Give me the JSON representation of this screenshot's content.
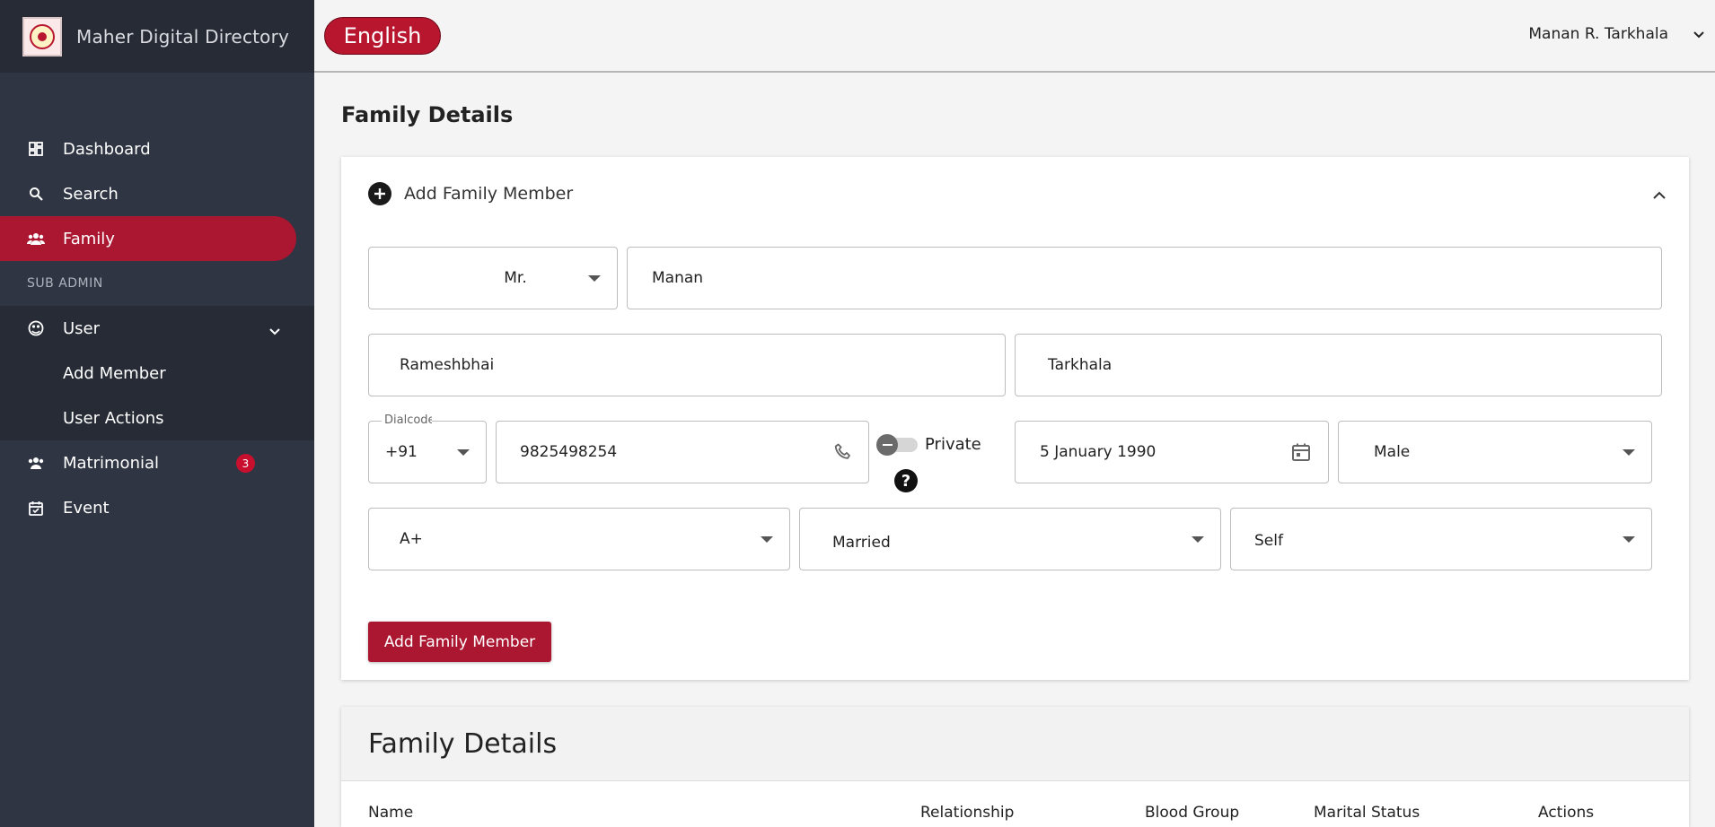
{
  "app": {
    "title": "Maher Digital Directory"
  },
  "header": {
    "language_label": "English",
    "user_name": "Manan R. Tarkhala"
  },
  "sidebar": {
    "items": [
      {
        "label": "Dashboard",
        "icon": "dashboard-icon"
      },
      {
        "label": "Search",
        "icon": "search-icon"
      },
      {
        "label": "Family",
        "icon": "family-icon",
        "active": true
      }
    ],
    "section_label": "SUB ADMIN",
    "user_group": {
      "label": "User",
      "icon": "user-icon",
      "children": [
        "Add Member",
        "User Actions"
      ]
    },
    "matrimonial": {
      "label": "Matrimonial",
      "badge": "3",
      "icon": "matrimonial-icon"
    },
    "event": {
      "label": "Event",
      "icon": "calendar-icon"
    }
  },
  "page": {
    "title": "Family Details"
  },
  "form": {
    "header_label": "Add Family Member",
    "salutation": "Mr.",
    "first_name": "Manan",
    "father_name": "Rameshbhai",
    "surname": "Tarkhala",
    "dialcode_label": "Dialcode",
    "dialcode": "+91",
    "phone": "9825498254",
    "private_label": "Private",
    "private_on": false,
    "birth_date": "5 January 1990",
    "gender": "Male",
    "blood_group": "A+",
    "marital_status": "Married",
    "relationship": "Self",
    "submit_label": "Add Family Member"
  },
  "table": {
    "title": "Family Details",
    "columns": [
      "Name",
      "Relationship",
      "Blood Group",
      "Marital Status",
      "Actions"
    ]
  },
  "colors": {
    "accent": "#ab1630",
    "sidebar_bg": "#2f3542",
    "sidebar_dark": "#262b36"
  }
}
